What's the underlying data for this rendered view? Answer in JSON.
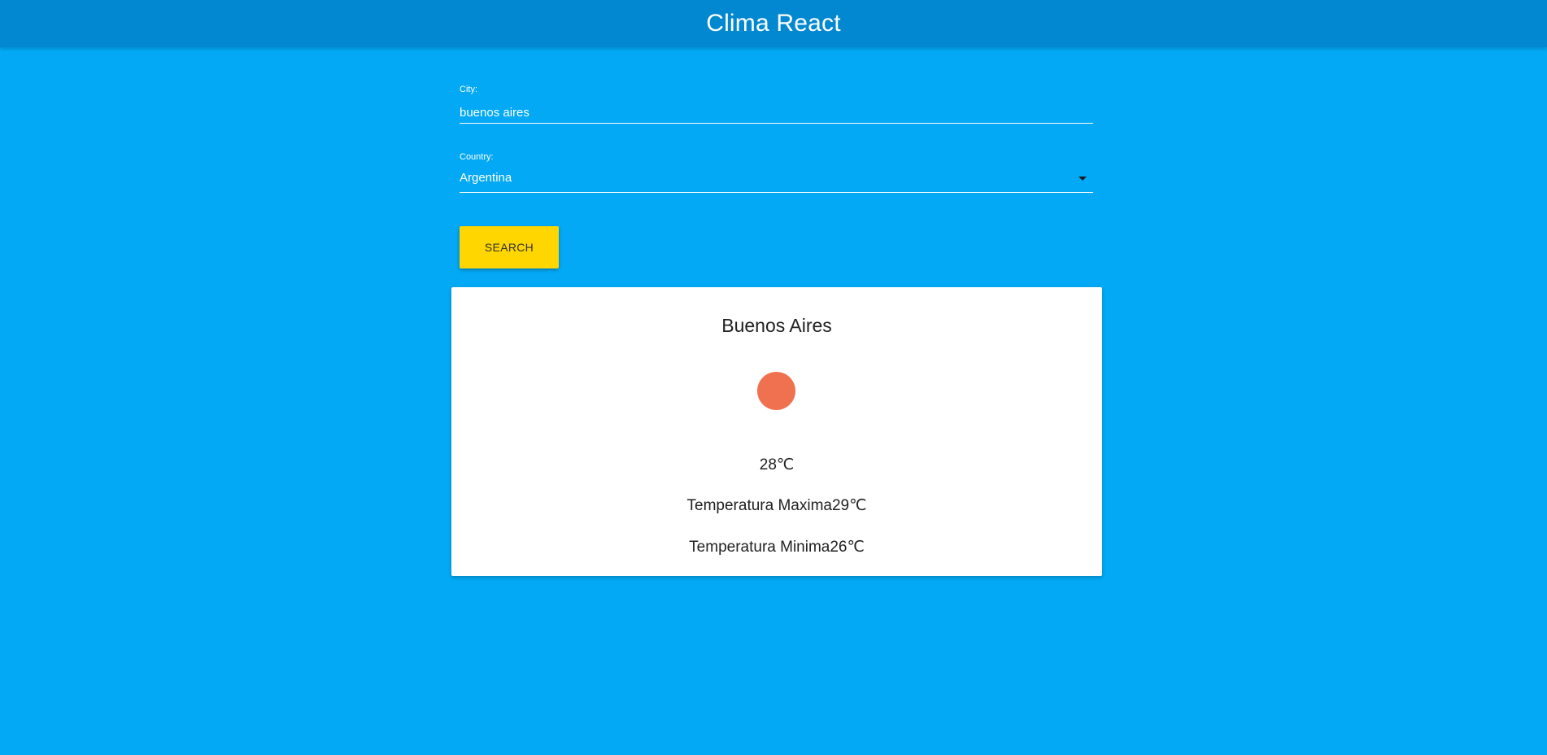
{
  "header": {
    "title": "Clima React"
  },
  "form": {
    "city_label": "City:",
    "city_value": "buenos aires",
    "country_label": "Country:",
    "country_value": "Argentina",
    "search_label": "SEARCH"
  },
  "result": {
    "city": "Buenos Aires",
    "weather_icon": "weather-icon",
    "current_temp": "28℃",
    "max_temp": "Temperatura Maxima29℃",
    "min_temp": "Temperatura Minima26℃"
  },
  "colors": {
    "page_background": "#03a9f4",
    "app_bar": "#0288d1",
    "button": "#ffd600",
    "weather_icon": "#ef7150"
  }
}
